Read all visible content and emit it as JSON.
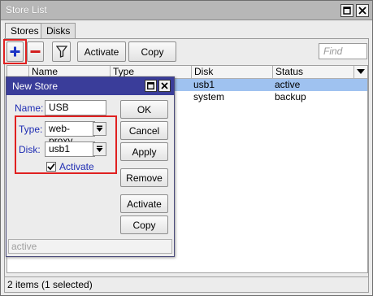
{
  "window": {
    "title": "Store List",
    "restore_icon": "restore-icon",
    "close_icon": "close-icon"
  },
  "tabs": [
    {
      "label": "Stores",
      "active": true
    },
    {
      "label": "Disks",
      "active": false
    }
  ],
  "toolbar": {
    "add_icon": "plus-icon",
    "remove_icon": "minus-icon",
    "filter_icon": "filter-icon",
    "activate_label": "Activate",
    "copy_label": "Copy",
    "find_placeholder": "Find"
  },
  "table": {
    "columns": [
      "Name",
      "Type",
      "Disk",
      "Status"
    ],
    "rows": [
      {
        "name": "",
        "type": "",
        "disk": "usb1",
        "status": "active",
        "selected": true
      },
      {
        "name": "",
        "type": "",
        "disk": "system",
        "status": "backup",
        "selected": false
      }
    ]
  },
  "status_bar": "2 items (1 selected)",
  "dialog": {
    "title": "New Store",
    "name_label": "Name:",
    "name_value": "USB",
    "type_label": "Type:",
    "type_value": "web-proxy",
    "disk_label": "Disk:",
    "disk_value": "usb1",
    "activate_label": "Activate",
    "activate_checked": true,
    "buttons": {
      "ok": "OK",
      "cancel": "Cancel",
      "apply": "Apply",
      "remove": "Remove",
      "activate": "Activate",
      "copy": "Copy"
    },
    "status": "active"
  },
  "colors": {
    "highlight": "#e02020",
    "selection": "#9fc2f0",
    "dialog_title": "#3a3d9a",
    "label": "#1f2db3"
  }
}
